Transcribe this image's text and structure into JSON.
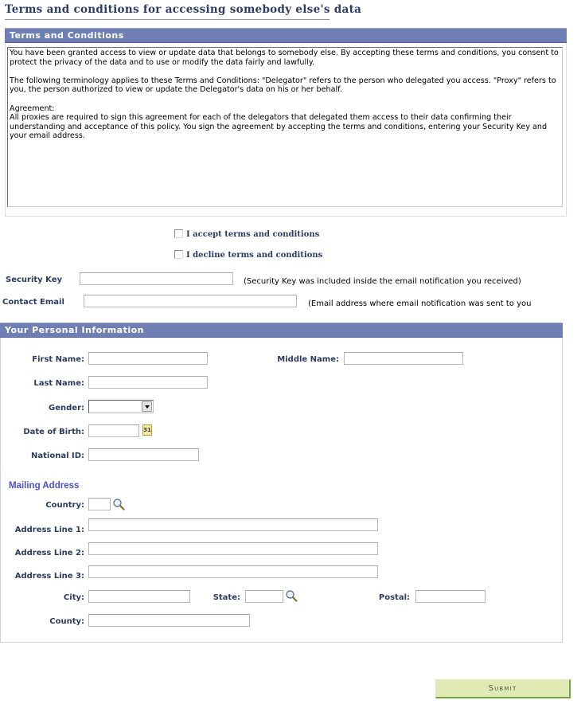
{
  "page": {
    "title": "Terms and conditions for accessing somebody else's data"
  },
  "terms_section": {
    "header": "Terms and Conditions",
    "paragraphs": [
      "You have been granted access to view or update data that belongs to somebody else. By accepting these terms and conditions, you consent to protect the privacy of the data and to use or modify the data fairly and lawfully.",
      "The following terminology applies to these Terms and Conditions: \"Delegator\" refers to the person who delegated you access.  \"Proxy\" refers to you, the person authorized to view or update the Delegator's data on his or her behalf.",
      "Agreement:\nAll proxies are required to sign this agreement for each of the delegators that delegated them access to their data confirming their understanding and acceptance of this policy. You sign the agreement by accepting the terms and conditions, entering your Security Key and your email address."
    ],
    "accept_label": "I accept terms and conditions",
    "accept_checked": false,
    "decline_label": "I decline terms and conditions",
    "decline_checked": false
  },
  "security": {
    "security_key_label": "Security Key",
    "security_key_value": "",
    "security_key_note": "(Security Key was included inside the email notification you received)",
    "contact_email_label": "Contact Email",
    "contact_email_value": "",
    "contact_email_note": "(Email address where email notification was sent to you"
  },
  "personal_info": {
    "header": "Your Personal Information",
    "first_name_label": "First Name:",
    "first_name_value": "",
    "middle_name_label": "Middle Name:",
    "middle_name_value": "",
    "last_name_label": "Last Name:",
    "last_name_value": "",
    "gender_label": "Gender:",
    "gender_value": "",
    "dob_label": "Date of Birth:",
    "dob_value": "",
    "calendar_icon_text": "31",
    "national_id_label": "National ID:",
    "national_id_value": ""
  },
  "mailing_address": {
    "header": "Mailing Address",
    "country_label": "Country:",
    "country_value": "",
    "address1_label": "Address Line 1:",
    "address1_value": "",
    "address2_label": "Address Line 2:",
    "address2_value": "",
    "address3_label": "Address Line 3:",
    "address3_value": "",
    "city_label": "City:",
    "city_value": "",
    "state_label": "State:",
    "state_value": "",
    "postal_label": "Postal:",
    "postal_value": "",
    "county_label": "County:",
    "county_value": ""
  },
  "actions": {
    "submit_label": "Submit"
  },
  "icons": {
    "lookup": "magnifying-glass",
    "calendar": "calendar",
    "dropdown": "chevron-down"
  },
  "colors": {
    "section_header_bg": "#6f7fb3",
    "label_text": "#2b3c62",
    "subheader_text": "#4b4fc7",
    "submit_bg": "#dfeab5",
    "submit_border": "#72a43c"
  }
}
